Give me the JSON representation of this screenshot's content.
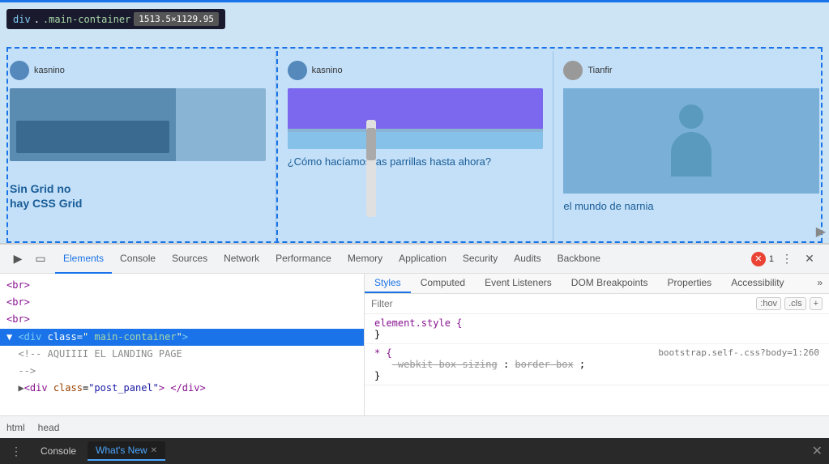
{
  "browser": {
    "accent_color": "#1a73e8"
  },
  "tooltip": {
    "tag": "div",
    "class": ".main-container",
    "size": "1513.5×1129.95"
  },
  "webpage": {
    "cards": [
      {
        "username": "kasnino",
        "bottom_text": "Sin Grid no\nhay CSS Grid"
      },
      {
        "username": "kasnino",
        "title": "¿Cómo hacíamos las parrillas hasta ahora?"
      },
      {
        "username": "Tianfir",
        "title": "el mundo de narnia"
      }
    ]
  },
  "devtools": {
    "tabs": [
      {
        "label": "Elements",
        "active": true
      },
      {
        "label": "Console",
        "active": false
      },
      {
        "label": "Sources",
        "active": false
      },
      {
        "label": "Network",
        "active": false
      },
      {
        "label": "Performance",
        "active": false
      },
      {
        "label": "Memory",
        "active": false
      },
      {
        "label": "Application",
        "active": false
      },
      {
        "label": "Security",
        "active": false
      },
      {
        "label": "Audits",
        "active": false
      },
      {
        "label": "Backbone",
        "active": false
      }
    ],
    "error_count": "1",
    "styles_tabs": [
      {
        "label": "Styles",
        "active": true
      },
      {
        "label": "Computed",
        "active": false
      },
      {
        "label": "Event Listeners",
        "active": false
      },
      {
        "label": "DOM Breakpoints",
        "active": false
      },
      {
        "label": "Properties",
        "active": false
      },
      {
        "label": "Accessibility",
        "active": false
      }
    ],
    "filter_placeholder": "Filter",
    "filter_hov": ":hov",
    "filter_cls": ".cls",
    "filter_plus": "+",
    "css_rules": [
      {
        "selector": "element.style {",
        "closing": "}",
        "properties": []
      },
      {
        "selector": "* {",
        "closing": "}",
        "file": "bootstrap.self-.css?body=1:260",
        "properties": [
          {
            "prop": "-webkit-box-sizing",
            "value": "border-box",
            "strikethrough": true
          }
        ]
      }
    ],
    "html_elements": [
      {
        "text": "<br>",
        "indent": 0
      },
      {
        "text": "<br>",
        "indent": 0
      },
      {
        "text": "<br>",
        "indent": 0
      },
      {
        "text": "<div class=\"main-container\">",
        "indent": 0,
        "selected": true
      },
      {
        "text": "<!-- AQUIIII EL LANDING PAGE",
        "indent": 1,
        "comment": true
      },
      {
        "text": "-->",
        "indent": 1,
        "comment": true
      },
      {
        "text": "▶<div class=\"post_panel\"> </div>",
        "indent": 1
      }
    ],
    "breadcrumb": [
      "html",
      "head"
    ],
    "bottom_tabs": [
      {
        "label": "Console",
        "active": false
      },
      {
        "label": "What's New",
        "active": true,
        "closeable": true
      }
    ]
  }
}
